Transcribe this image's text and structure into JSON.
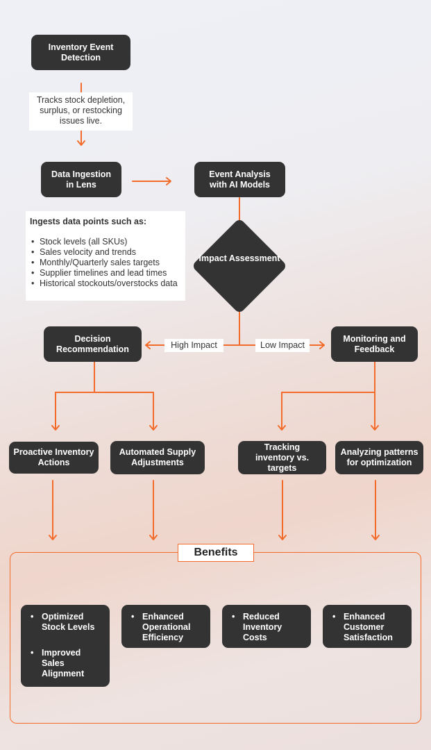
{
  "theme": {
    "accent": "#f26b2a",
    "node_bg": "#333333",
    "node_text": "#ffffff",
    "note_bg": "#ffffff"
  },
  "nodes": {
    "detection": "Inventory Event Detection",
    "ingestion": "Data Ingestion in Lens",
    "analysis": "Event Analysis with AI Models",
    "impact": "Impact Assessment",
    "decision": "Decision Recommendation",
    "monitoring": "Monitoring and Feedback",
    "proactive": "Proactive Inventory Actions",
    "automated": "Automated Supply Adjustments",
    "tracking": "Tracking inventory vs. targets",
    "analyzing": "Analyzing patterns for optimization"
  },
  "notes": {
    "detection_note": "Tracks stock depletion, surplus, or restocking issues live.",
    "ingestion_note": {
      "heading": "Ingests data points such as:",
      "items": [
        "Stock levels (all SKUs)",
        "Sales velocity and trends",
        "Monthly/Quarterly sales targets",
        "Supplier timelines and lead times",
        "Historical stockouts/overstocks data"
      ]
    }
  },
  "edge_labels": {
    "high": "High Impact",
    "low": "Low Impact"
  },
  "benefits": {
    "title": "Benefits",
    "cards": [
      {
        "items": [
          "Optimized Stock Levels",
          "Improved Sales Alignment"
        ]
      },
      {
        "items": [
          "Enhanced Operational Efficiency"
        ]
      },
      {
        "items": [
          "Reduced Inventory Costs"
        ]
      },
      {
        "items": [
          "Enhanced Customer Satisfaction"
        ]
      }
    ]
  }
}
